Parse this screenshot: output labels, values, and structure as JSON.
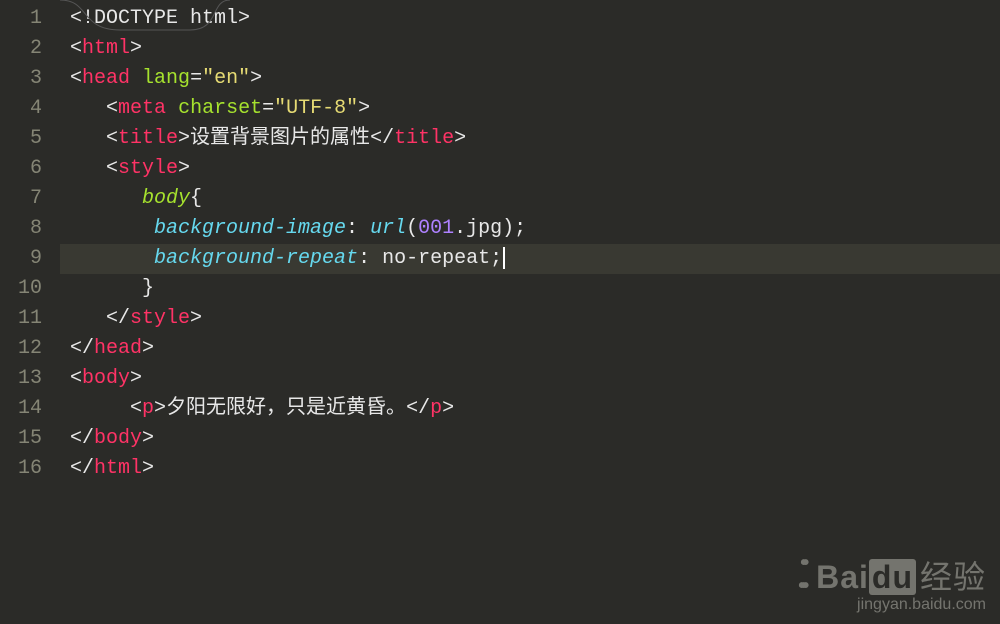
{
  "editor": {
    "highlightedLine": 9,
    "lineNumbers": [
      "1",
      "2",
      "3",
      "4",
      "5",
      "6",
      "7",
      "8",
      "9",
      "10",
      "11",
      "12",
      "13",
      "14",
      "15",
      "16"
    ],
    "lines": [
      [
        {
          "cls": "tok-punc",
          "t": "<!"
        },
        {
          "cls": "tok-doctype",
          "t": "DOCTYPE html"
        },
        {
          "cls": "tok-punc",
          "t": ">"
        }
      ],
      [
        {
          "cls": "tok-punc",
          "t": "<"
        },
        {
          "cls": "tok-tag",
          "t": "html"
        },
        {
          "cls": "tok-punc",
          "t": ">"
        }
      ],
      [
        {
          "cls": "tok-punc",
          "t": "<"
        },
        {
          "cls": "tok-tag",
          "t": "head"
        },
        {
          "cls": "tok-text",
          "t": " "
        },
        {
          "cls": "tok-attr",
          "t": "lang"
        },
        {
          "cls": "tok-punc",
          "t": "="
        },
        {
          "cls": "tok-string",
          "t": "\"en\""
        },
        {
          "cls": "tok-punc",
          "t": ">"
        }
      ],
      [
        {
          "cls": "tok-text",
          "t": "   "
        },
        {
          "cls": "tok-punc",
          "t": "<"
        },
        {
          "cls": "tok-tag",
          "t": "meta"
        },
        {
          "cls": "tok-text",
          "t": " "
        },
        {
          "cls": "tok-attr",
          "t": "charset"
        },
        {
          "cls": "tok-punc",
          "t": "="
        },
        {
          "cls": "tok-string",
          "t": "\"UTF-8\""
        },
        {
          "cls": "tok-punc",
          "t": ">"
        }
      ],
      [
        {
          "cls": "tok-text",
          "t": "   "
        },
        {
          "cls": "tok-punc",
          "t": "<"
        },
        {
          "cls": "tok-tag",
          "t": "title"
        },
        {
          "cls": "tok-punc",
          "t": ">"
        },
        {
          "cls": "tok-text",
          "t": "设置背景图片的属性"
        },
        {
          "cls": "tok-punc",
          "t": "</"
        },
        {
          "cls": "tok-tag",
          "t": "title"
        },
        {
          "cls": "tok-punc",
          "t": ">"
        }
      ],
      [
        {
          "cls": "tok-text",
          "t": "   "
        },
        {
          "cls": "tok-punc",
          "t": "<"
        },
        {
          "cls": "tok-tag",
          "t": "style"
        },
        {
          "cls": "tok-punc",
          "t": ">"
        }
      ],
      [
        {
          "cls": "tok-text",
          "t": "      "
        },
        {
          "cls": "tok-selector",
          "t": "body"
        },
        {
          "cls": "tok-brace",
          "t": "{"
        }
      ],
      [
        {
          "cls": "tok-text",
          "t": "       "
        },
        {
          "cls": "tok-prop",
          "t": "background-image"
        },
        {
          "cls": "tok-punc",
          "t": ": "
        },
        {
          "cls": "tok-valfn",
          "t": "url"
        },
        {
          "cls": "tok-punc",
          "t": "("
        },
        {
          "cls": "tok-num",
          "t": "001"
        },
        {
          "cls": "tok-value",
          "t": ".jpg"
        },
        {
          "cls": "tok-punc",
          "t": ");"
        }
      ],
      [
        {
          "cls": "tok-text",
          "t": "       "
        },
        {
          "cls": "tok-prop",
          "t": "background-repeat"
        },
        {
          "cls": "tok-punc",
          "t": ": "
        },
        {
          "cls": "tok-value",
          "t": "no-repeat"
        },
        {
          "cls": "tok-punc",
          "t": ";"
        },
        {
          "cursor": true
        }
      ],
      [
        {
          "cls": "tok-text",
          "t": "      "
        },
        {
          "cls": "tok-brace",
          "t": "}"
        }
      ],
      [
        {
          "cls": "tok-text",
          "t": "   "
        },
        {
          "cls": "tok-punc",
          "t": "</"
        },
        {
          "cls": "tok-tag",
          "t": "style"
        },
        {
          "cls": "tok-punc",
          "t": ">"
        }
      ],
      [
        {
          "cls": "tok-punc",
          "t": "</"
        },
        {
          "cls": "tok-tag",
          "t": "head"
        },
        {
          "cls": "tok-punc",
          "t": ">"
        }
      ],
      [
        {
          "cls": "tok-punc",
          "t": "<"
        },
        {
          "cls": "tok-tag",
          "t": "body"
        },
        {
          "cls": "tok-punc",
          "t": ">"
        }
      ],
      [
        {
          "cls": "tok-text",
          "t": "     "
        },
        {
          "cls": "tok-punc",
          "t": "<"
        },
        {
          "cls": "tok-tag",
          "t": "p"
        },
        {
          "cls": "tok-punc",
          "t": ">"
        },
        {
          "cls": "tok-text",
          "t": "夕阳无限好，只是近黄昏。"
        },
        {
          "cls": "tok-punc",
          "t": "</"
        },
        {
          "cls": "tok-tag",
          "t": "p"
        },
        {
          "cls": "tok-punc",
          "t": ">"
        }
      ],
      [
        {
          "cls": "tok-punc",
          "t": "</"
        },
        {
          "cls": "tok-tag",
          "t": "body"
        },
        {
          "cls": "tok-punc",
          "t": ">"
        }
      ],
      [
        {
          "cls": "tok-punc",
          "t": "</"
        },
        {
          "cls": "tok-tag",
          "t": "html"
        },
        {
          "cls": "tok-punc",
          "t": ">"
        }
      ]
    ]
  },
  "watermark": {
    "brand": "Bai",
    "brand2": "du",
    "suffix": "经验",
    "url": "jingyan.baidu.com"
  }
}
